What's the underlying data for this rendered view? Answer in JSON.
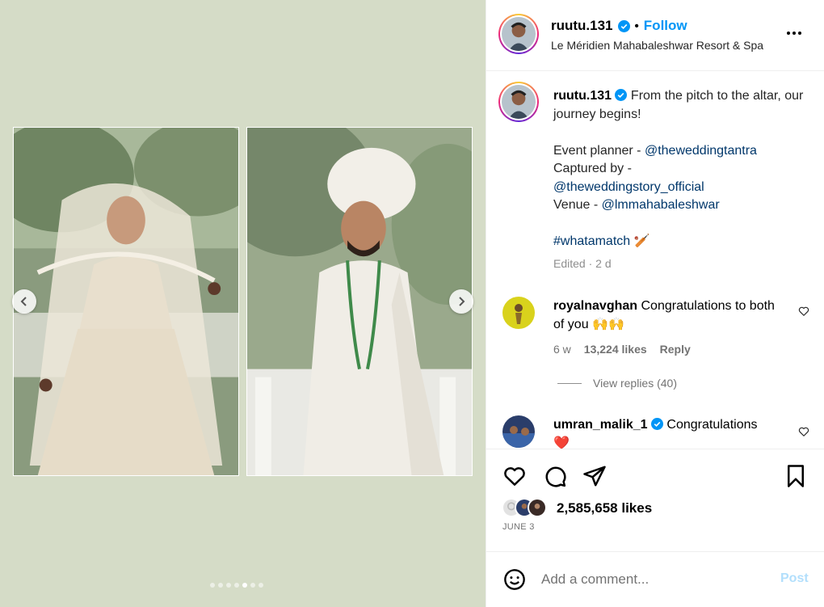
{
  "post": {
    "username": "ruutu.131",
    "follow_label": "Follow",
    "bullet": "•",
    "location": "Le Méridien Mahabaleshwar Resort & Spa"
  },
  "caption": {
    "username": "ruutu.131",
    "line1": "From the pitch to the altar, our journey begins!",
    "planner_label": "Event planner - ",
    "planner_handle": "@theweddingtantra",
    "captured_label": "Captured by - ",
    "captured_handle": "@theweddingstory_official",
    "venue_label": "Venue - ",
    "venue_handle": "@lmmahabaleshwar",
    "hashtag": "#whatamatch",
    "hashtag_emoji": "🏏",
    "edited": "Edited · 2 d"
  },
  "comments": [
    {
      "username": "royalnavghan",
      "text": "Congratulations to both of you 🙌🙌",
      "age": "6 w",
      "likes": "13,224 likes",
      "reply_label": "Reply",
      "view_replies": "View replies (40)"
    },
    {
      "username": "umran_malik_1",
      "text": "Congratulations",
      "emoji": "❤️"
    }
  ],
  "engagement": {
    "likes": "2,585,658 likes",
    "date": "JUNE 3"
  },
  "composer": {
    "placeholder": "Add a comment...",
    "post_label": "Post"
  },
  "carousel": {
    "slide_count": 7,
    "active_slide": 4
  },
  "colors": {
    "media_background": "#d5dcc7",
    "link": "#00376b",
    "follow": "#0095f6",
    "verified": "#0095f6",
    "post_disabled": "#b2dffc"
  }
}
